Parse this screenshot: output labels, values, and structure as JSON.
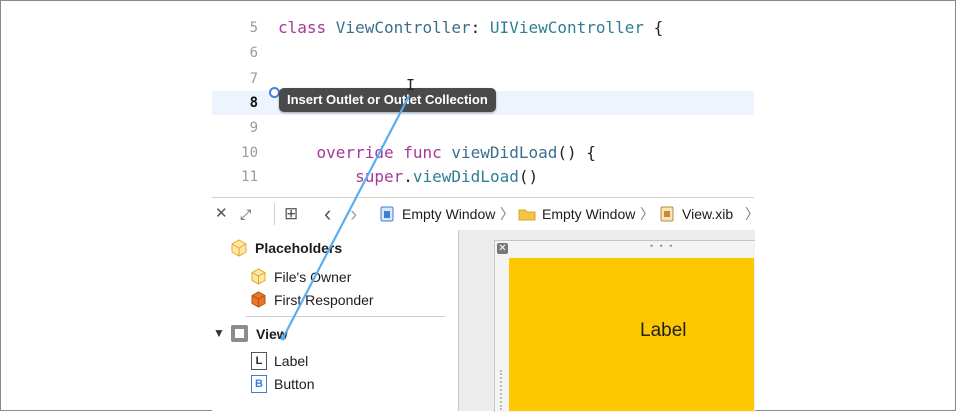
{
  "editor": {
    "lines": [
      {
        "number": "5",
        "tokens": [
          {
            "t": "kw",
            "v": "class "
          },
          {
            "t": "fn",
            "v": "ViewController"
          },
          {
            "t": "pl",
            "v": ": "
          },
          {
            "t": "ty",
            "v": "UIViewController"
          },
          {
            "t": "pl",
            "v": " {"
          }
        ]
      },
      {
        "number": "6",
        "tokens": []
      },
      {
        "number": "7",
        "tokens": []
      },
      {
        "number": "8",
        "tokens": []
      },
      {
        "number": "9",
        "tokens": []
      },
      {
        "number": "10",
        "tokens": [
          {
            "t": "pl",
            "v": "    "
          },
          {
            "t": "kw",
            "v": "override func "
          },
          {
            "t": "fn",
            "v": "viewDidLoad"
          },
          {
            "t": "pl",
            "v": "() {"
          }
        ]
      },
      {
        "number": "11",
        "tokens": [
          {
            "t": "pl",
            "v": "        "
          },
          {
            "t": "kw",
            "v": "super"
          },
          {
            "t": "pl",
            "v": "."
          },
          {
            "t": "ty",
            "v": "viewDidLoad"
          },
          {
            "t": "pl",
            "v": "()"
          }
        ]
      }
    ],
    "current_line": "8",
    "tooltip": "Insert Outlet or Outlet Collection"
  },
  "jumpbar": {
    "close_glyph": "✕",
    "expand_glyph": "⤢",
    "grid_glyph": "⊞",
    "back_glyph": "‹",
    "forward_glyph": "›",
    "crumbs": [
      {
        "label": "Empty Window",
        "icon": "project-file-icon"
      },
      {
        "label": "Empty Window",
        "icon": "folder-icon"
      },
      {
        "label": "View.xib",
        "icon": "xib-file-icon"
      }
    ],
    "crumb_separator": "〉"
  },
  "outline": {
    "placeholders_label": "Placeholders",
    "files_owner_label": "File's Owner",
    "first_responder_label": "First Responder",
    "view_label": "View",
    "children": [
      {
        "badge": "L",
        "label": "Label"
      },
      {
        "badge": "B",
        "label": "Button"
      }
    ]
  },
  "canvas": {
    "close_glyph": "✕",
    "dots": "• • •",
    "label_text": "Label"
  },
  "colors": {
    "keyword": "#a9379b",
    "type": "#2e7f95",
    "connection_line": "#5aaef0",
    "canvas_yellow": "#fec800"
  }
}
